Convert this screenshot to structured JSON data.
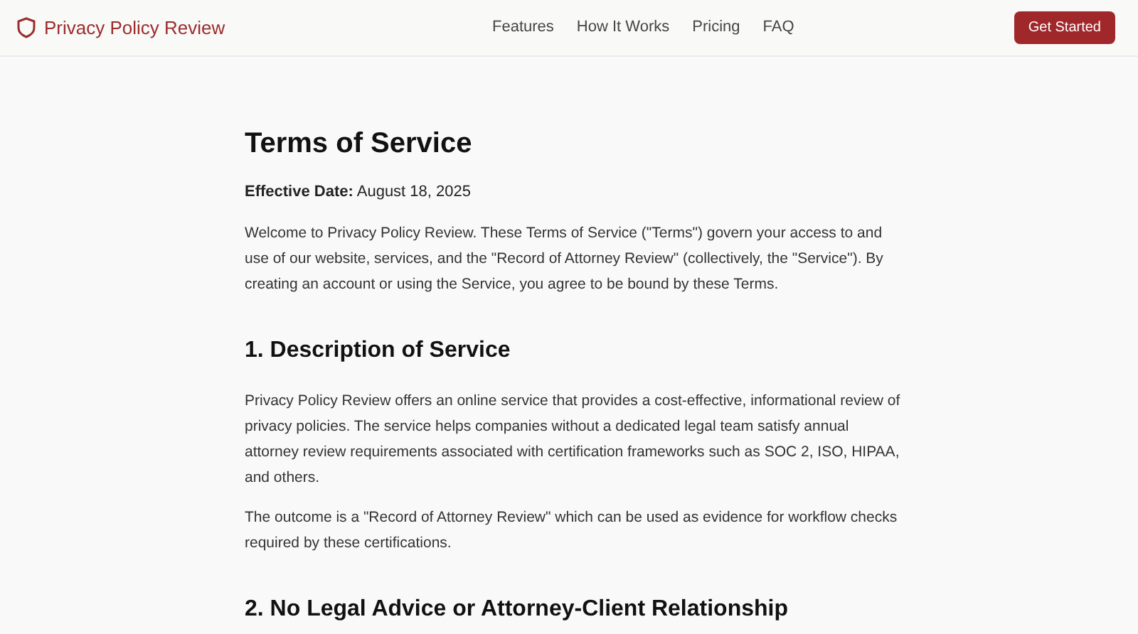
{
  "header": {
    "brand": "Privacy Policy Review",
    "nav": [
      {
        "label": "Features"
      },
      {
        "label": "How It Works"
      },
      {
        "label": "Pricing"
      },
      {
        "label": "FAQ"
      }
    ],
    "cta": "Get Started"
  },
  "title": "Terms of Service",
  "effective": "**Effective Date:** August 18, 2025",
  "intro": [
    "Welcome to Privacy Policy Review. These Terms of Service (\"Terms\") govern your access to and use of our website, services, and the \"Record of Attorney Review\" (collectively, the \"Service\"). By creating an account or using the Service, you agree to be bound by these Terms."
  ],
  "sections": [
    {
      "heading": "1. Description of Service",
      "paragraphs": [
        "Privacy Policy Review offers an online service that provides a cost-effective, informational review of privacy policies. The service helps companies without a dedicated legal team satisfy annual attorney review requirements associated with certification frameworks such as SOC 2, ISO, HIPAA, and others.",
        "The outcome is a \"Record of Attorney Review\" which can be used as evidence for workflow checks required by these certifications."
      ]
    },
    {
      "heading": "2. No Legal Advice or Attorney-Client Relationship"
    }
  ]
}
